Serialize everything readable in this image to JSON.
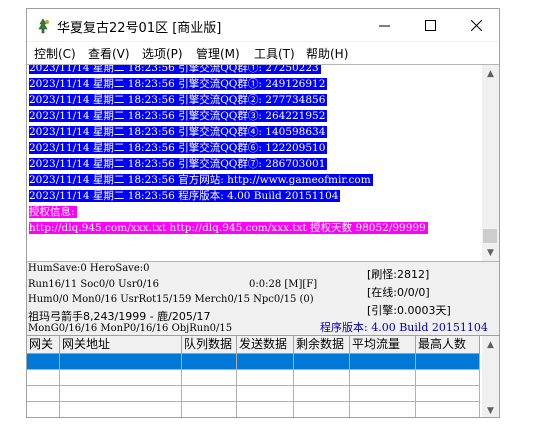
{
  "window": {
    "title": "华夏复古22号01区 [商业版]"
  },
  "menu": [
    "控制(C)",
    "查看(V)",
    "选项(P)",
    "管理(M)",
    "工具(T)",
    "帮助(H)"
  ],
  "log": {
    "lines": [
      {
        "text": "2023/11/14 星期二 18:23:56 引擎交流QQ群①: 27250223",
        "style": "sel"
      },
      {
        "text": "2023/11/14 星期二 18:23:56 引擎交流QQ群①: 249126912",
        "style": "sel"
      },
      {
        "text": "2023/11/14 星期二 18:23:56 引擎交流QQ群②: 277734856",
        "style": "sel"
      },
      {
        "text": "2023/11/14 星期二 18:23:56 引擎交流QQ群③: 264221952",
        "style": "sel"
      },
      {
        "text": "2023/11/14 星期二 18:23:56 引擎交流QQ群④: 140598634",
        "style": "sel"
      },
      {
        "text": "2023/11/14 星期二 18:23:56 引擎交流QQ群⑥: 122209510",
        "style": "sel"
      },
      {
        "text": "2023/11/14 星期二 18:23:56 引擎交流QQ群⑦: 286703001",
        "style": "sel"
      },
      {
        "text": "2023/11/14 星期二 18:23:56 官方网站: http://www.gameofmir.com",
        "style": "sel"
      },
      {
        "text": "2023/11/14 星期二 18:23:56 程序版本: 4.00 Build 20151104",
        "style": "sel"
      },
      {
        "text": "授权信息:",
        "style": "mag"
      },
      {
        "text": "http://dlq.945.com/xxx.txt http://dlq.945.com/xxx.txt 授权天数 98052/99999",
        "style": "mag"
      }
    ]
  },
  "status": {
    "hum_save": "HumSave:0 HeroSave:0",
    "run": "Run16/11 Soc0/0 Usr0/16",
    "timer": "0:0:28 [M][F]",
    "hum": "Hum0/0 Mon0/16 UsrRot15/159 Merch0/15 Npc0/15 (0)",
    "player": "祖玛弓箭手8,243/1999 - 鹿/205/17",
    "mon_g": "MonG0/16/16 MonP0/16/16 ObjRun0/15",
    "refresh": "[刷怪:2812]",
    "online": "[在线:0/0/0]",
    "engine": "[引擎:0.0003天]",
    "version": "程序版本: 4.00 Build 20151104"
  },
  "grid": {
    "headers": [
      "网关",
      "网关地址",
      "队列数据",
      "发送数据",
      "剩余数据",
      "平均流量",
      "最高人数"
    ],
    "row_count": 4
  },
  "colors": {
    "selection": "#0000ff",
    "magenta": "#ff00ff",
    "version_text": "#0000c0"
  }
}
